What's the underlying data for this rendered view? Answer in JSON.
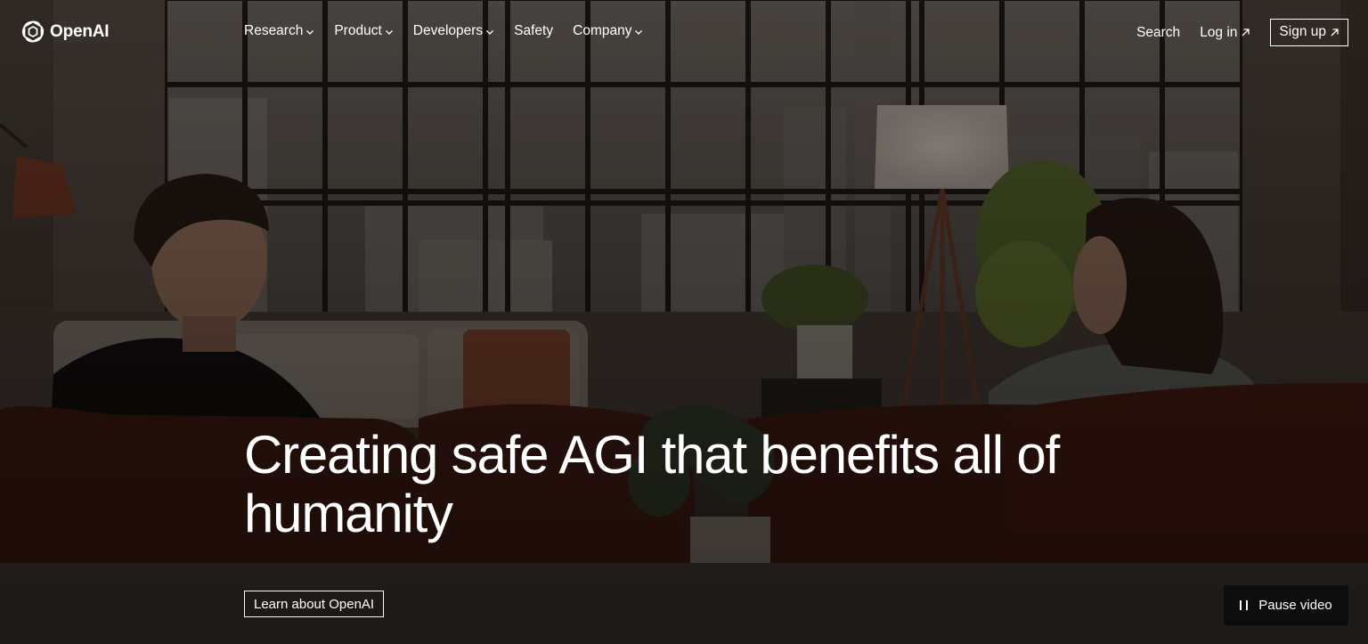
{
  "brand": {
    "name": "OpenAI",
    "logo_icon": "openai-logo-icon"
  },
  "nav": {
    "items": [
      {
        "label": "Research",
        "has_dropdown": true
      },
      {
        "label": "Product",
        "has_dropdown": true
      },
      {
        "label": "Developers",
        "has_dropdown": true
      },
      {
        "label": "Safety",
        "has_dropdown": false
      },
      {
        "label": "Company",
        "has_dropdown": true
      }
    ],
    "search_label": "Search",
    "login_label": "Log in",
    "signup_label": "Sign up",
    "external_icon": "arrow-up-right-icon",
    "dropdown_icon": "chevron-down-icon"
  },
  "hero": {
    "headline": "Creating safe AGI that benefits all of humanity",
    "cta_label": "Learn about OpenAI",
    "pause_label": "Pause video",
    "pause_icon": "pause-icon"
  },
  "colors": {
    "text": "#ffffff",
    "pause_bg": "#0d0d0d",
    "overlay": "#2a221d"
  }
}
